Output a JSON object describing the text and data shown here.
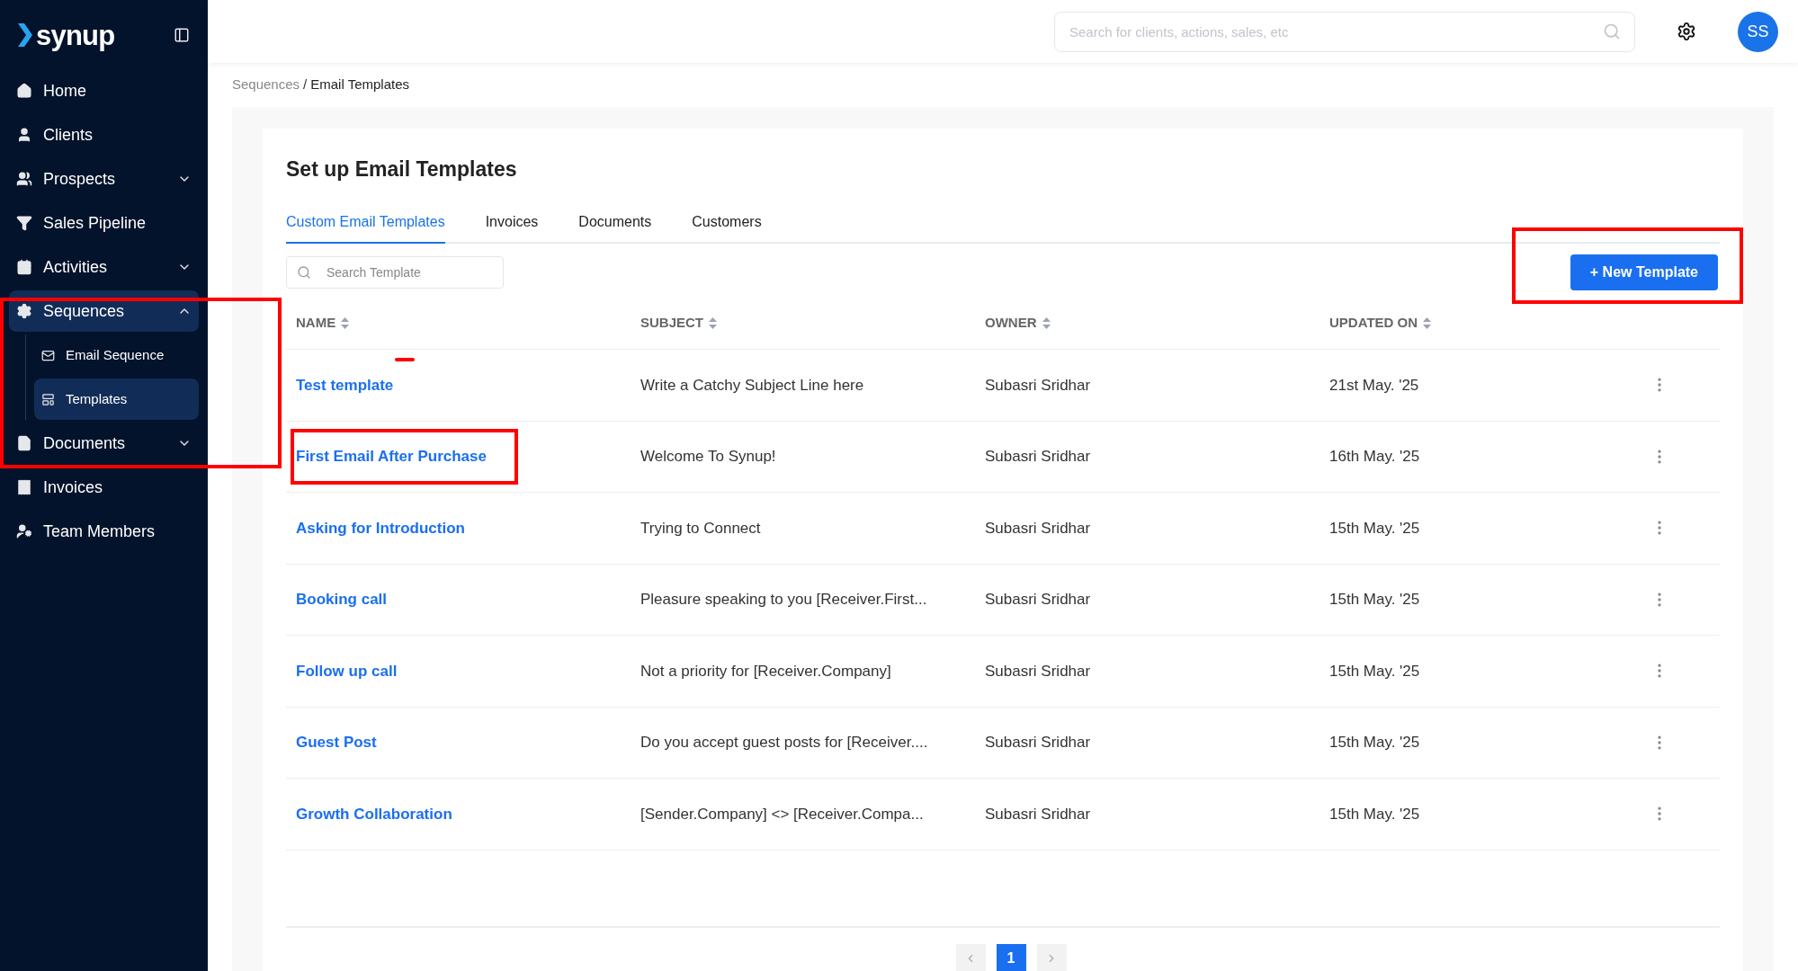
{
  "brand": {
    "name": "synup"
  },
  "sidebar": {
    "items": [
      {
        "label": "Home",
        "selected": false
      },
      {
        "label": "Clients",
        "selected": false
      },
      {
        "label": "Prospects",
        "selected": false,
        "expanded": false
      },
      {
        "label": "Sales Pipeline",
        "selected": false
      },
      {
        "label": "Activities",
        "selected": false,
        "expanded": false
      },
      {
        "label": "Sequences",
        "selected": true,
        "expanded": true,
        "highlighted": true,
        "children": [
          {
            "label": "Email Sequence",
            "selected": false
          },
          {
            "label": "Templates",
            "selected": true
          }
        ]
      },
      {
        "label": "Documents",
        "selected": false,
        "expanded": false
      },
      {
        "label": "Invoices",
        "selected": false
      },
      {
        "label": "Team Members",
        "selected": false
      }
    ]
  },
  "header": {
    "search": {
      "placeholder": "Search for clients, actions, sales, etc"
    },
    "avatar": "SS"
  },
  "breadcrumb": [
    "Sequences",
    "Email Templates"
  ],
  "breadcrumb_separator": "/",
  "page": {
    "title": "Set up Email Templates",
    "tabs": [
      {
        "label": "Custom Email Templates",
        "selected": true
      },
      {
        "label": "Invoices",
        "selected": false
      },
      {
        "label": "Documents",
        "selected": false
      },
      {
        "label": "Customers",
        "selected": false
      }
    ],
    "search": {
      "placeholder": "Search Template"
    },
    "new_button": {
      "label": "+ New Template",
      "highlighted": true
    },
    "table": {
      "columns": [
        "NAME",
        "SUBJECT",
        "OWNER",
        "UPDATED ON"
      ],
      "rows": [
        {
          "name": "Test template",
          "subject": "Write a Catchy Subject Line here",
          "owner": "Subasri Sridhar",
          "updated": "21st May. '25",
          "highlighted": false,
          "marked": true
        },
        {
          "name": "First Email After Purchase",
          "subject": "Welcome To Synup!",
          "owner": "Subasri Sridhar",
          "updated": "16th May. '25",
          "highlighted": true,
          "marked": false
        },
        {
          "name": "Asking for Introduction",
          "subject": "Trying to Connect",
          "owner": "Subasri Sridhar",
          "updated": "15th May. '25",
          "highlighted": false,
          "marked": false
        },
        {
          "name": "Booking call",
          "subject": "Pleasure speaking to you [Receiver.First...",
          "owner": "Subasri Sridhar",
          "updated": "15th May. '25",
          "highlighted": false,
          "marked": false
        },
        {
          "name": "Follow up call",
          "subject": "Not a priority for [Receiver.Company]",
          "owner": "Subasri Sridhar",
          "updated": "15th May. '25",
          "highlighted": false,
          "marked": false
        },
        {
          "name": "Guest Post",
          "subject": "Do you accept guest posts for [Receiver....",
          "owner": "Subasri Sridhar",
          "updated": "15th May. '25",
          "highlighted": false,
          "marked": false
        },
        {
          "name": "Growth Collaboration",
          "subject": "[Sender.Company] <> [Receiver.Compa...",
          "owner": "Subasri Sridhar",
          "updated": "15th May. '25",
          "highlighted": false,
          "marked": false
        }
      ]
    },
    "pagination": [
      {
        "label": "1",
        "selected": true
      }
    ]
  }
}
